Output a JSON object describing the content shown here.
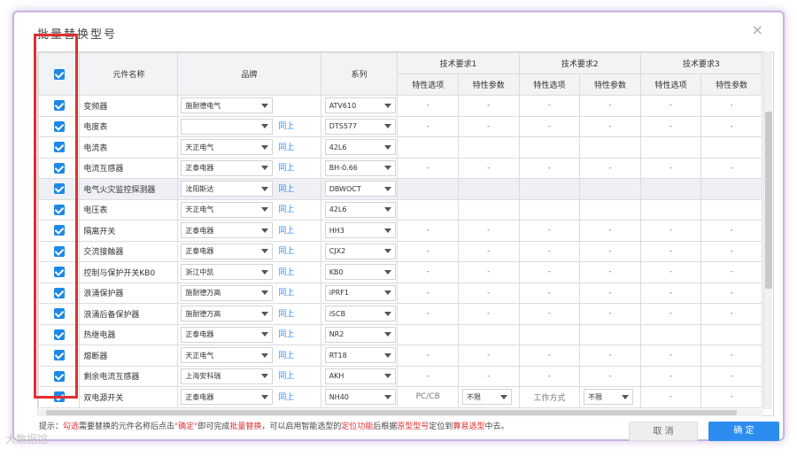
{
  "dialog": {
    "title": "批量替换型号",
    "close_icon": "×"
  },
  "table": {
    "headers": {
      "name": "元件名称",
      "brand": "品牌",
      "series": "系列",
      "req1": "技术要求1",
      "req2": "技术要求2",
      "req3": "技术要求3",
      "option": "特性选项",
      "param": "特性参数"
    },
    "rows": [
      {
        "name": "变频器",
        "brand": "施耐德电气",
        "same": "",
        "series": "ATV610",
        "o1": "-",
        "p1": "-",
        "o2": "-",
        "p2": "-",
        "o3": "-",
        "p3": "-"
      },
      {
        "name": "电度表",
        "brand": "",
        "same": "同上",
        "series": "DTS577",
        "o1": "-",
        "p1": "-",
        "o2": "-",
        "p2": "-",
        "o3": "-",
        "p3": "-"
      },
      {
        "name": "电流表",
        "brand": "天正电气",
        "same": "同上",
        "series": "42L6",
        "o1": "",
        "p1": "",
        "o2": "",
        "p2": "",
        "o3": "",
        "p3": ""
      },
      {
        "name": "电流互感器",
        "brand": "正泰电器",
        "same": "同上",
        "series": "BH-0.66",
        "o1": "-",
        "p1": "-",
        "o2": "-",
        "p2": "-",
        "o3": "-",
        "p3": "-"
      },
      {
        "name": "电气火灾监控探测器",
        "brand": "沈阳斯达",
        "same": "同上",
        "series": "DBWOCT",
        "o1": "",
        "p1": "",
        "o2": "",
        "p2": "",
        "o3": "",
        "p3": ""
      },
      {
        "name": "电压表",
        "brand": "天正电气",
        "same": "同上",
        "series": "42L6",
        "o1": "",
        "p1": "",
        "o2": "",
        "p2": "",
        "o3": "",
        "p3": ""
      },
      {
        "name": "隔离开关",
        "brand": "正泰电器",
        "same": "同上",
        "series": "HH3",
        "o1": "-",
        "p1": "-",
        "o2": "-",
        "p2": "-",
        "o3": "-",
        "p3": "-"
      },
      {
        "name": "交流接触器",
        "brand": "正泰电器",
        "same": "同上",
        "series": "CJX2",
        "o1": "-",
        "p1": "-",
        "o2": "-",
        "p2": "-",
        "o3": "-",
        "p3": "-"
      },
      {
        "name": "控制与保护开关KB0",
        "brand": "浙江中凯",
        "same": "同上",
        "series": "KB0",
        "o1": "-",
        "p1": "-",
        "o2": "-",
        "p2": "-",
        "o3": "-",
        "p3": "-"
      },
      {
        "name": "浪涌保护器",
        "brand": "施耐德万高",
        "same": "同上",
        "series": "iPRF1",
        "o1": "-",
        "p1": "-",
        "o2": "-",
        "p2": "-",
        "o3": "-",
        "p3": "-"
      },
      {
        "name": "浪涌后备保护器",
        "brand": "施耐德万高",
        "same": "同上",
        "series": "iSCB",
        "o1": "-",
        "p1": "-",
        "o2": "-",
        "p2": "-",
        "o3": "-",
        "p3": "-"
      },
      {
        "name": "热继电器",
        "brand": "正泰电器",
        "same": "同上",
        "series": "NR2",
        "o1": "",
        "p1": "",
        "o2": "",
        "p2": "",
        "o3": "",
        "p3": ""
      },
      {
        "name": "熔断器",
        "brand": "天正电气",
        "same": "同上",
        "series": "RT18",
        "o1": "-",
        "p1": "-",
        "o2": "-",
        "p2": "-",
        "o3": "-",
        "p3": "-"
      },
      {
        "name": "剩余电流互感器",
        "brand": "上海安科瑞",
        "same": "同上",
        "series": "AKH",
        "o1": "-",
        "p1": "-",
        "o2": "-",
        "p2": "-",
        "o3": "-",
        "p3": "-"
      },
      {
        "name": "双电源开关",
        "brand": "正泰电器",
        "same": "同上",
        "series": "NH40",
        "o1": "PC/CB",
        "p1": "不限",
        "o2": "工作方式",
        "p2": "不限",
        "o3": "-",
        "p3": "-"
      }
    ]
  },
  "tip": {
    "prefix": "提示：",
    "r1": "勾选",
    "t1": "需要替换的元件名称后点击",
    "r2": "\"确定\"",
    "t2": "即可完成",
    "r3": "批量替换",
    "t3": "，可以启用智能选型的",
    "r4": "定位功能",
    "t4": "后根据",
    "r5": "原型型号",
    "t5": "定位到",
    "r6": "算易选型",
    "t6": "中去。"
  },
  "buttons": {
    "cancel": "取 消",
    "ok": "确 定"
  },
  "watermark": "大数据馆",
  "colors": {
    "accent": "#2d8cf0",
    "highlight": "#e03030",
    "checkbox": "#1e88e5"
  }
}
